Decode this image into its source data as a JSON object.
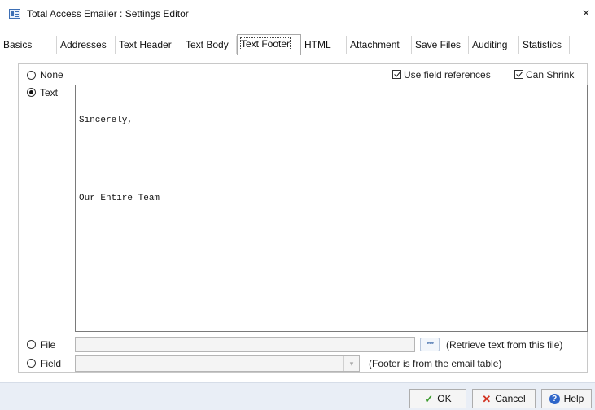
{
  "window": {
    "title": "Total Access Emailer : Settings Editor",
    "close_glyph": "×"
  },
  "tabs": [
    {
      "label": "Basics"
    },
    {
      "label": "Addresses"
    },
    {
      "label": "Text Header"
    },
    {
      "label": "Text Body"
    },
    {
      "label": "Text Footer",
      "active": true
    },
    {
      "label": "HTML"
    },
    {
      "label": "Attachment"
    },
    {
      "label": "Save Files"
    },
    {
      "label": "Auditing"
    },
    {
      "label": "Statistics"
    }
  ],
  "options": {
    "none_label": "None",
    "text_label": "Text",
    "file_label": "File",
    "field_label": "Field",
    "selected": "Text",
    "use_field_references_label": "Use field references",
    "use_field_references_checked": true,
    "can_shrink_label": "Can Shrink",
    "can_shrink_checked": true
  },
  "footer_text": {
    "lines": [
      "Sincerely,",
      "",
      "Our Entire Team"
    ]
  },
  "file": {
    "value": "",
    "browse_glyph": "•••",
    "hint": "(Retrieve text from this file)"
  },
  "field": {
    "value": "",
    "hint": "(Footer is from the email table)"
  },
  "buttons": {
    "ok_label": "OK",
    "cancel_label": "Cancel",
    "help_label": "Help"
  },
  "colors": {
    "footer_bar": "#e9eef6",
    "ok_icon": "#3a9a2b",
    "cancel_icon": "#d2311f",
    "help_icon": "#2f66c9"
  }
}
